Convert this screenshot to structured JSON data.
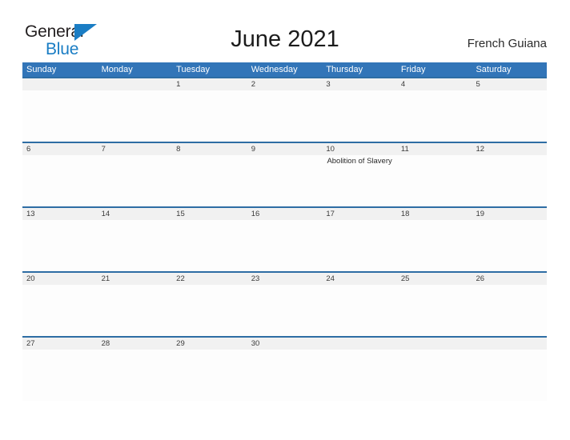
{
  "brand": {
    "name_part1": "General",
    "name_part2": "Blue",
    "flag_color": "#1a7dc4",
    "text_color": "#231f20"
  },
  "header": {
    "title": "June 2021",
    "region": "French Guiana"
  },
  "theme": {
    "header_blue": "#3275b8",
    "row_border_blue": "#2e6da4",
    "daynum_band_gray": "#f1f1f1",
    "page_background": "#ffffff"
  },
  "calendar": {
    "weekdays": [
      "Sunday",
      "Monday",
      "Tuesday",
      "Wednesday",
      "Thursday",
      "Friday",
      "Saturday"
    ],
    "weeks": [
      {
        "days": [
          {
            "num": "",
            "event": ""
          },
          {
            "num": "",
            "event": ""
          },
          {
            "num": "1",
            "event": ""
          },
          {
            "num": "2",
            "event": ""
          },
          {
            "num": "3",
            "event": ""
          },
          {
            "num": "4",
            "event": ""
          },
          {
            "num": "5",
            "event": ""
          }
        ]
      },
      {
        "days": [
          {
            "num": "6",
            "event": ""
          },
          {
            "num": "7",
            "event": ""
          },
          {
            "num": "8",
            "event": ""
          },
          {
            "num": "9",
            "event": ""
          },
          {
            "num": "10",
            "event": "Abolition of Slavery"
          },
          {
            "num": "11",
            "event": ""
          },
          {
            "num": "12",
            "event": ""
          }
        ]
      },
      {
        "days": [
          {
            "num": "13",
            "event": ""
          },
          {
            "num": "14",
            "event": ""
          },
          {
            "num": "15",
            "event": ""
          },
          {
            "num": "16",
            "event": ""
          },
          {
            "num": "17",
            "event": ""
          },
          {
            "num": "18",
            "event": ""
          },
          {
            "num": "19",
            "event": ""
          }
        ]
      },
      {
        "days": [
          {
            "num": "20",
            "event": ""
          },
          {
            "num": "21",
            "event": ""
          },
          {
            "num": "22",
            "event": ""
          },
          {
            "num": "23",
            "event": ""
          },
          {
            "num": "24",
            "event": ""
          },
          {
            "num": "25",
            "event": ""
          },
          {
            "num": "26",
            "event": ""
          }
        ]
      },
      {
        "days": [
          {
            "num": "27",
            "event": ""
          },
          {
            "num": "28",
            "event": ""
          },
          {
            "num": "29",
            "event": ""
          },
          {
            "num": "30",
            "event": ""
          },
          {
            "num": "",
            "event": ""
          },
          {
            "num": "",
            "event": ""
          },
          {
            "num": "",
            "event": ""
          }
        ]
      }
    ]
  }
}
